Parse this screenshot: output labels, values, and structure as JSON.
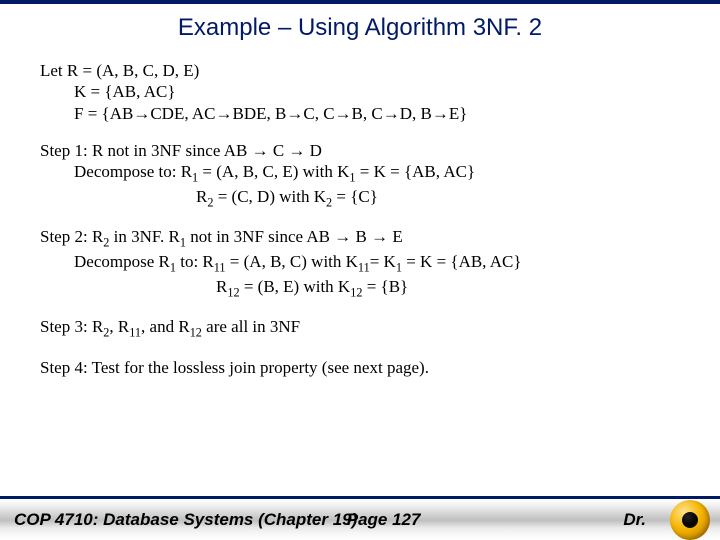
{
  "title": "Example – Using Algorithm 3NF. 2",
  "given": {
    "line1": "Let R = (A, B, C, D, E)",
    "line2": "K = {AB, AC}",
    "line3_a": "F = {AB",
    "line3_b": "CDE, AC",
    "line3_c": "BDE, B",
    "line3_d": "C, C",
    "line3_e": "B, C",
    "line3_f": "D, B",
    "line3_g": "E}"
  },
  "step1": {
    "l1a": "Step 1: R not in 3NF since AB ",
    "l1b": " C ",
    "l1c": " D",
    "l2a": "Decompose to:  R",
    "l2a_s": "1",
    "l2b": " = (A, B, C, E) with K",
    "l2b_s": "1",
    "l2c": " = K = {AB, AC}",
    "l3a": "R",
    "l3a_s": "2",
    "l3b": " = (C, D) with K",
    "l3b_s": "2",
    "l3c": " = {C}"
  },
  "step2": {
    "l1a": "Step 2: R",
    "l1a_s": "2",
    "l1b": " in 3NF.   R",
    "l1b_s": "1",
    "l1c": " not in 3NF since AB ",
    "l1d": " B ",
    "l1e": " E",
    "l2a": "Decompose R",
    "l2a_s": "1",
    "l2b": " to:  R",
    "l2b_s": "11",
    "l2c": " = (A, B, C) with K",
    "l2c_s": "11",
    "l2d": "= K",
    "l2d_s": "1",
    "l2e": " = K = {AB, AC}",
    "l3a": "R",
    "l3a_s": "12",
    "l3b": " = (B, E) with K",
    "l3b_s": "12",
    "l3c": " = {B}"
  },
  "step3": {
    "a": "Step 3: R",
    "a_s": "2",
    "b": ", R",
    "b_s": "11",
    "c": ", and R",
    "c_s": "12",
    "d": " are all in 3NF"
  },
  "step4": "Step 4: Test for the lossless join property (see next page).",
  "footer": {
    "left": "COP 4710: Database Systems  (Chapter 19)",
    "center": "Page 127",
    "right": "Dr."
  },
  "arrow": "→"
}
